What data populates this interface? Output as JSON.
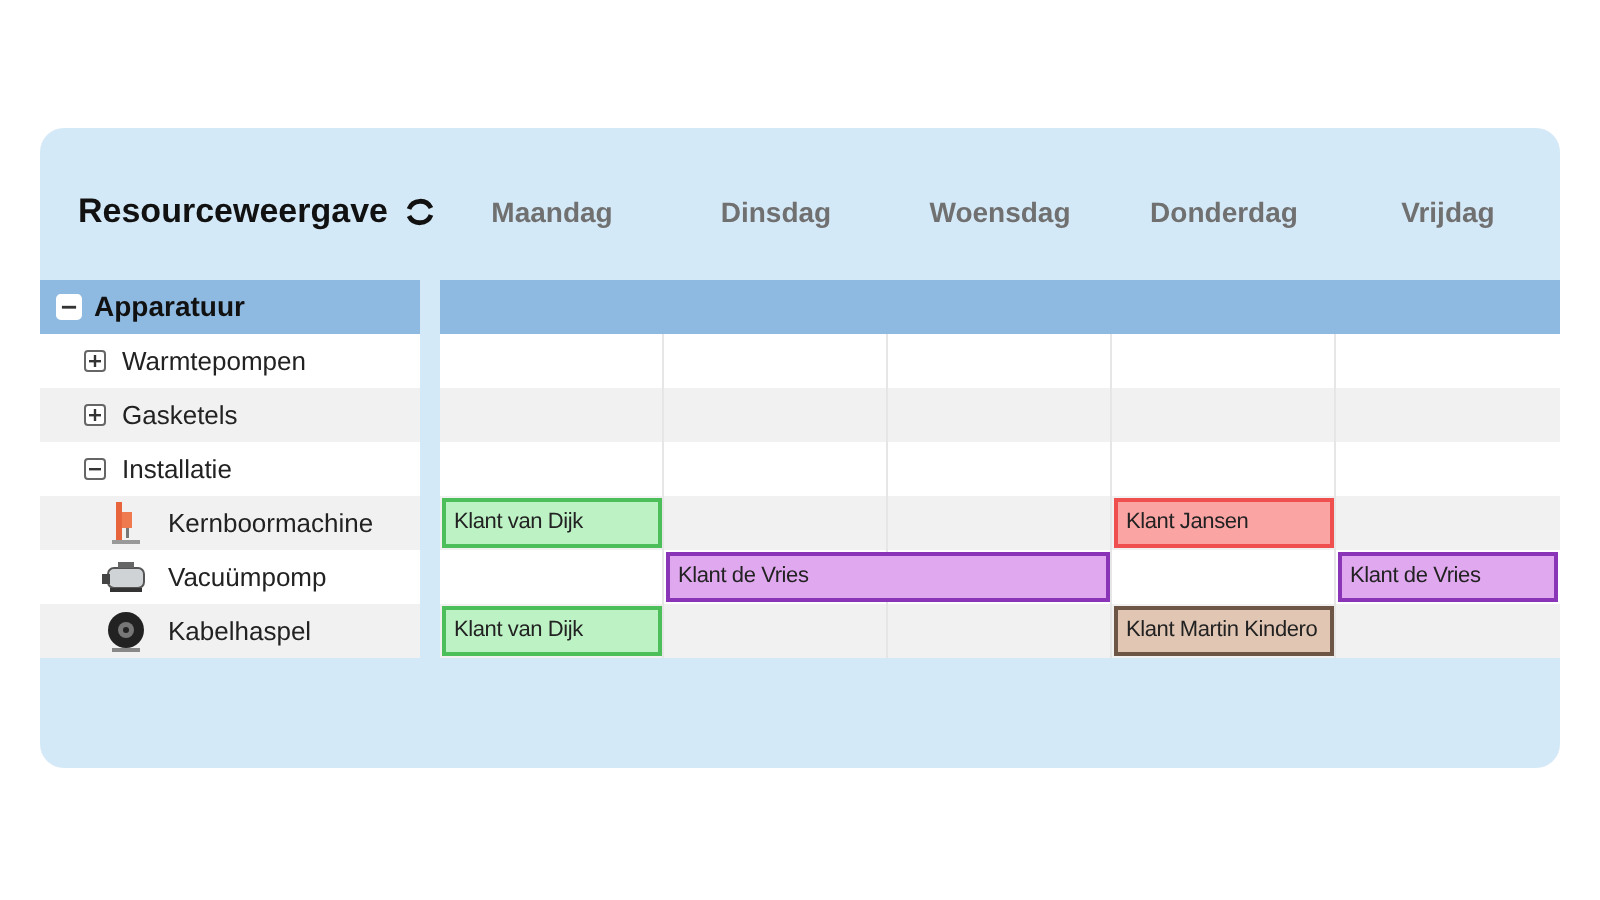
{
  "title": "Resourceweergave",
  "days": [
    "Maandag",
    "Dinsdag",
    "Woensdag",
    "Donderdag",
    "Vrijdag"
  ],
  "tree": [
    {
      "label": "Apparatuur",
      "expanded": true,
      "children": [
        {
          "label": "Warmtepompen",
          "expanded": false
        },
        {
          "label": "Gasketels",
          "expanded": false
        },
        {
          "label": "Installatie",
          "expanded": true,
          "children": [
            {
              "label": "Kernboormachine",
              "kind": "drill",
              "slots": [
                {
                  "kind": "event",
                  "label": "Klant van Dijk",
                  "color": "#bdf2c4"
                },
                {
                  "kind": "empty"
                },
                {
                  "kind": "empty"
                },
                {
                  "kind": "event",
                  "label": "Klant Jansen",
                  "color": "#fba4a4"
                },
                {
                  "kind": "empty"
                }
              ]
            },
            {
              "label": "Vacuümpomp",
              "kind": "pump",
              "slots": [
                {
                  "kind": "empty"
                },
                {
                  "kind": "event",
                  "label": "Klant de Vries",
                  "color": "#e0a8ef"
                },
                {
                  "kind": "continued"
                },
                {
                  "kind": "empty"
                },
                {
                  "kind": "event",
                  "label": "Klant de Vries",
                  "color": "#e0a8ef"
                }
              ]
            },
            {
              "label": "Kabelhaspel",
              "kind": "reel",
              "slots": [
                {
                  "kind": "event",
                  "label": "Klant van Dijk",
                  "color": "#bdf2c4"
                },
                {
                  "kind": "empty"
                },
                {
                  "kind": "empty"
                },
                {
                  "kind": "event",
                  "label": "Klant Martin Kindero",
                  "color": "#e0c6b3"
                },
                {
                  "kind": "empty"
                }
              ]
            }
          ]
        }
      ]
    }
  ]
}
